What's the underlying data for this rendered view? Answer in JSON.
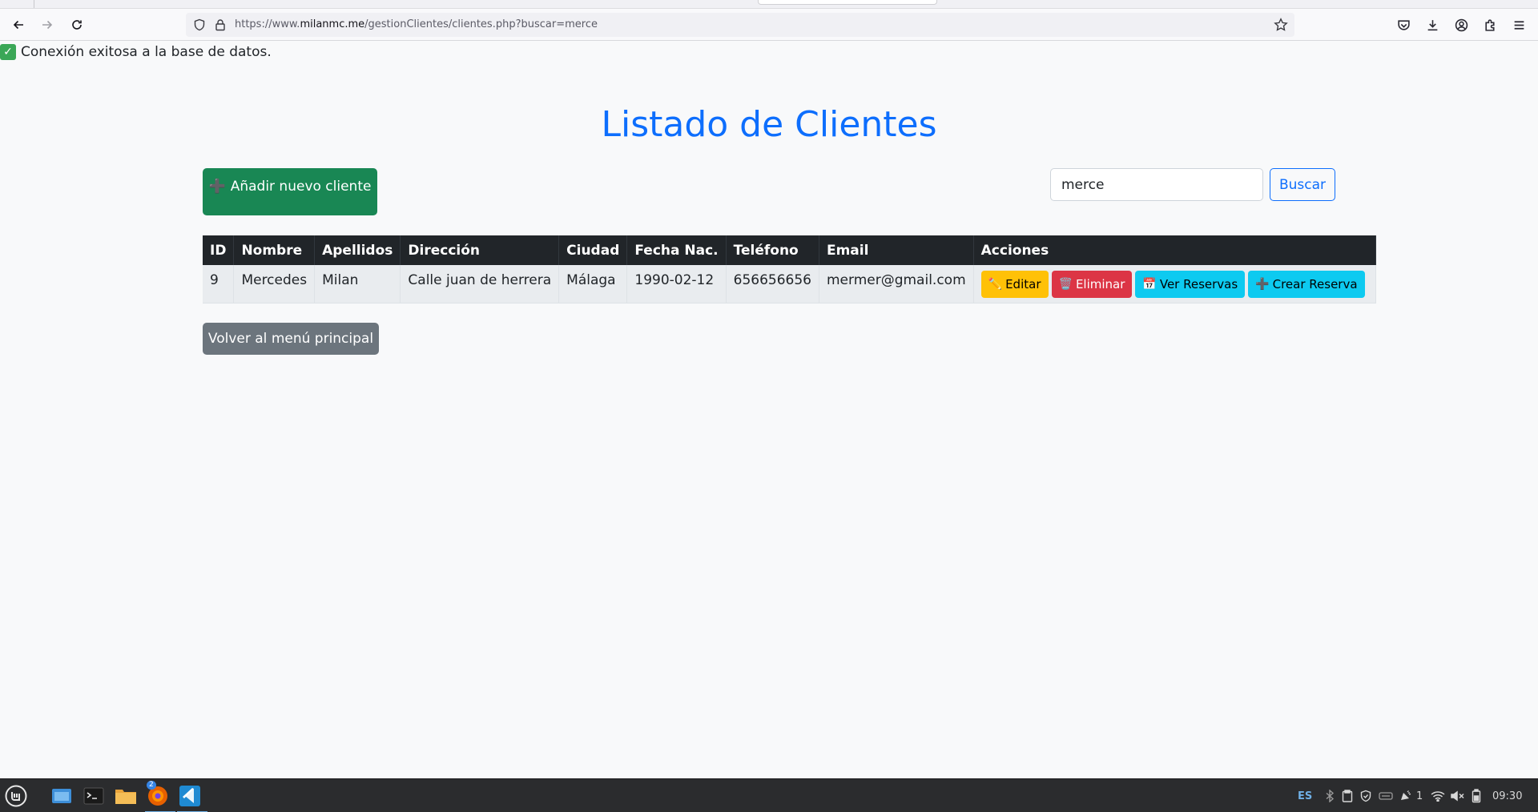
{
  "browser": {
    "url_prefix": "https://www.",
    "url_host": "milanmc.me",
    "url_path": "/gestionClientes/clientes.php?buscar=merce"
  },
  "status": {
    "icon": "check-mark-icon",
    "message": "Conexión exitosa a la base de datos."
  },
  "page": {
    "title": "Listado de Clientes",
    "add_button": "Añadir nuevo cliente",
    "search_value": "merce",
    "search_button": "Buscar",
    "back_button": "Volver al menú principal"
  },
  "table": {
    "headers": [
      "ID",
      "Nombre",
      "Apellidos",
      "Dirección",
      "Ciudad",
      "Fecha Nac.",
      "Teléfono",
      "Email",
      "Acciones"
    ],
    "rows": [
      {
        "id": "9",
        "nombre": "Mercedes",
        "apellidos": "Milan",
        "direccion": "Calle juan de herrera",
        "ciudad": "Málaga",
        "fecha_nac": "1990-02-12",
        "telefono": "656656656",
        "email": "mermer@gmail.com",
        "actions": {
          "edit": "Editar",
          "delete": "Eliminar",
          "view_reservations": "Ver Reservas",
          "create_reservation": "Crear Reserva"
        }
      }
    ]
  },
  "taskbar": {
    "badge_count": "2",
    "language": "ES",
    "notif_count": "1",
    "clock": "09:30"
  },
  "colors": {
    "primary": "#0d6efd",
    "success": "#198754",
    "warning": "#ffc107",
    "danger": "#dc3545",
    "info": "#0dcaf0",
    "secondary": "#6c757d"
  }
}
